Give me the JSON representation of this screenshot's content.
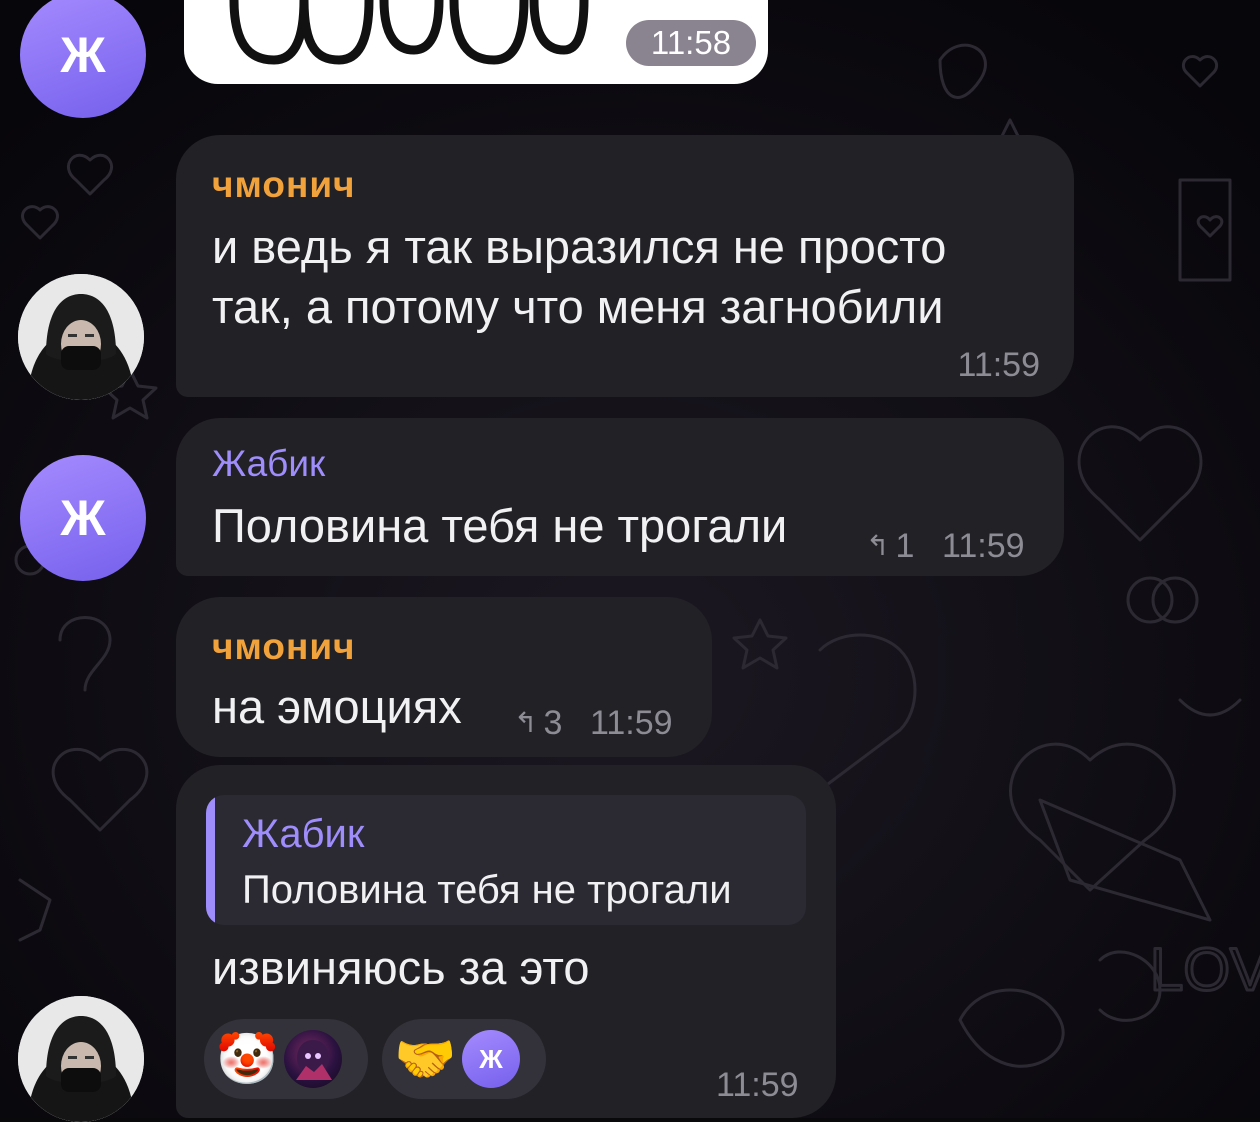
{
  "chat": {
    "background_color": "#09080b",
    "bubble_color": "#222126",
    "accent_colors": {
      "orange_sender": "#f2a23a",
      "violet_sender": "#9f8dfc",
      "avatar_violet": "#8a71f7"
    }
  },
  "top_message": {
    "time": "11:58",
    "avatar_letter": "Ж"
  },
  "messages": [
    {
      "sender": "чмонич",
      "lines": [
        "и ведь я так выразился не просто",
        "так, а потому что меня загнобили"
      ],
      "time": "11:59",
      "avatar": "hooded-person-photo"
    },
    {
      "sender": "Жабик",
      "text": "Половина тебя не трогали",
      "replies": "1",
      "time": "11:59",
      "avatar_letter": "Ж"
    },
    {
      "sender": "чмонич",
      "text": "на эмоциях",
      "replies": "3",
      "time": "11:59"
    },
    {
      "quote_sender": "Жабик",
      "quote_text": "Половина тебя не трогали",
      "text": "извиняюсь за это",
      "time": "11:59",
      "avatar": "hooded-person-photo",
      "reactions": [
        {
          "emoji": "🤡",
          "icon": "clown-face-icon",
          "user_avatar": "dark-art-avatar"
        },
        {
          "emoji": "🤝",
          "icon": "handshake-icon",
          "user_avatar_letter": "Ж"
        }
      ]
    }
  ]
}
